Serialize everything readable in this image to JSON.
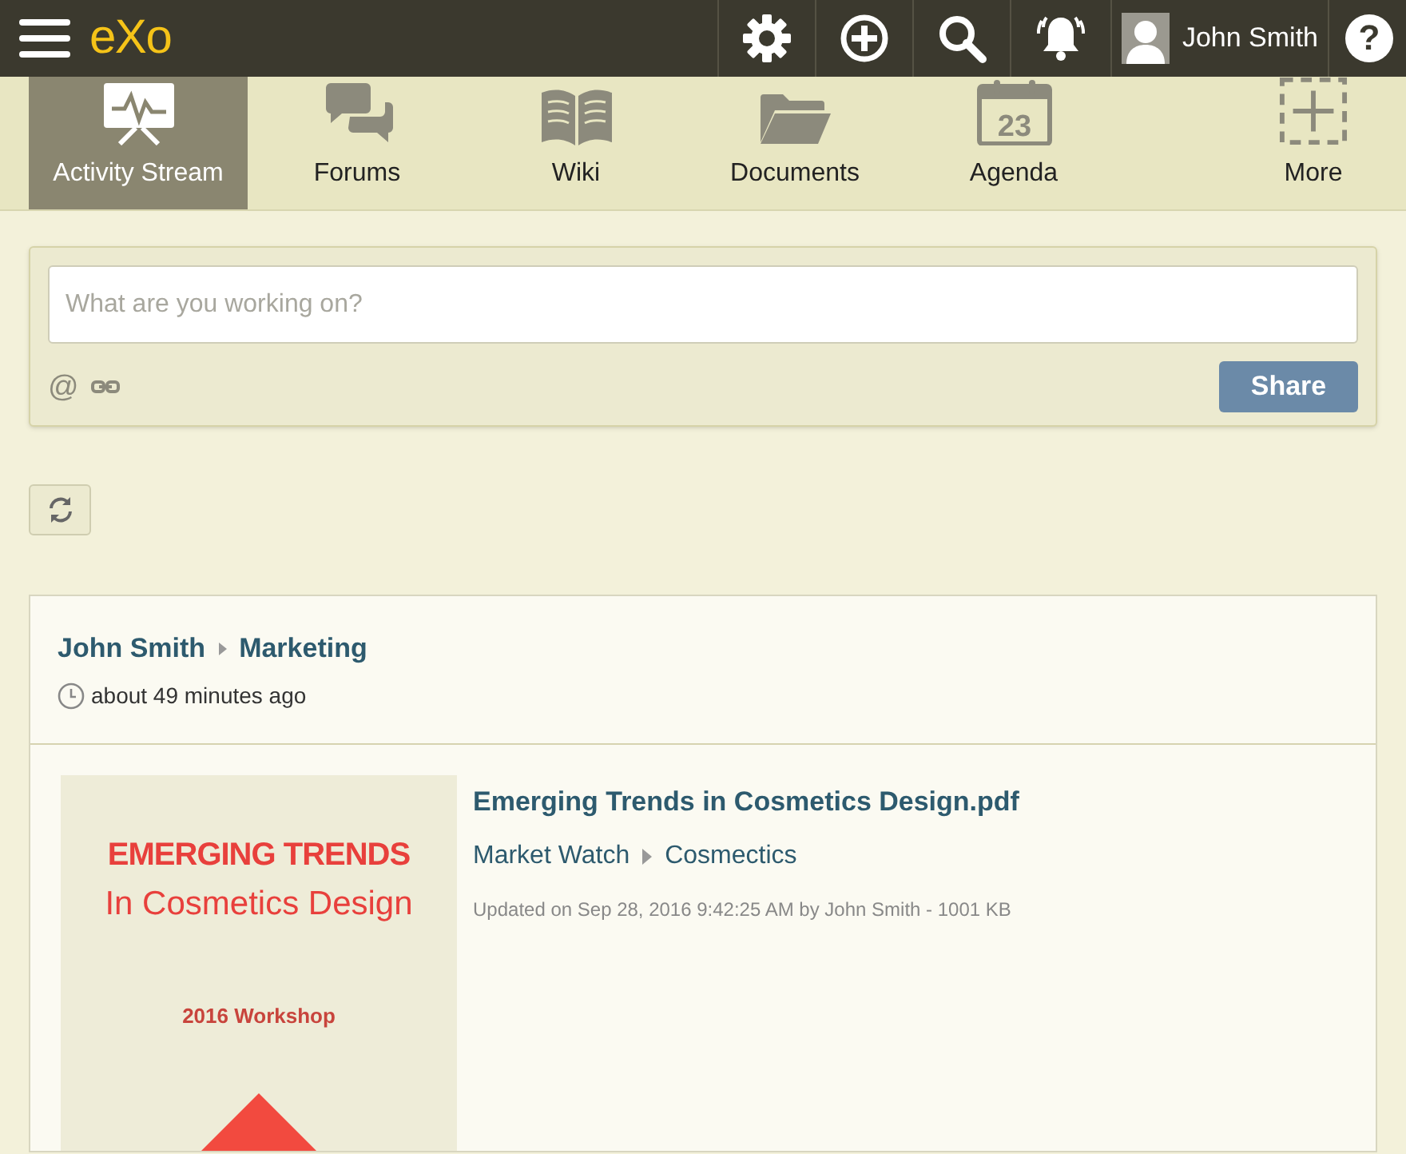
{
  "top_bar": {
    "logo": "eXo",
    "user": {
      "name": "John Smith"
    },
    "help": "?"
  },
  "apps": [
    {
      "label": "Activity Stream",
      "kind": "activity",
      "selected": true
    },
    {
      "label": "Forums",
      "kind": "forums",
      "selected": false
    },
    {
      "label": "Wiki",
      "kind": "wiki",
      "selected": false
    },
    {
      "label": "Documents",
      "kind": "documents",
      "selected": false
    },
    {
      "label": "Agenda",
      "kind": "agenda",
      "selected": false,
      "day": "23"
    },
    {
      "label": "More",
      "kind": "more",
      "selected": false
    }
  ],
  "composer": {
    "placeholder": "What are you working on?",
    "mention": "@",
    "button": "Share"
  },
  "activity": {
    "author": "John Smith",
    "space": "Marketing",
    "time": "about 49 minutes ago",
    "document": {
      "title": "Emerging Trends in Cosmetics Design.pdf",
      "path": [
        "Market Watch",
        "Cosmectics"
      ],
      "meta": "Updated on Sep 28, 2016 9:42:25 AM by John Smith - 1001 KB",
      "preview": {
        "heading": "EMERGING TRENDS",
        "subheading": "In Cosmetics Design",
        "event": "2016 Workshop"
      }
    }
  }
}
